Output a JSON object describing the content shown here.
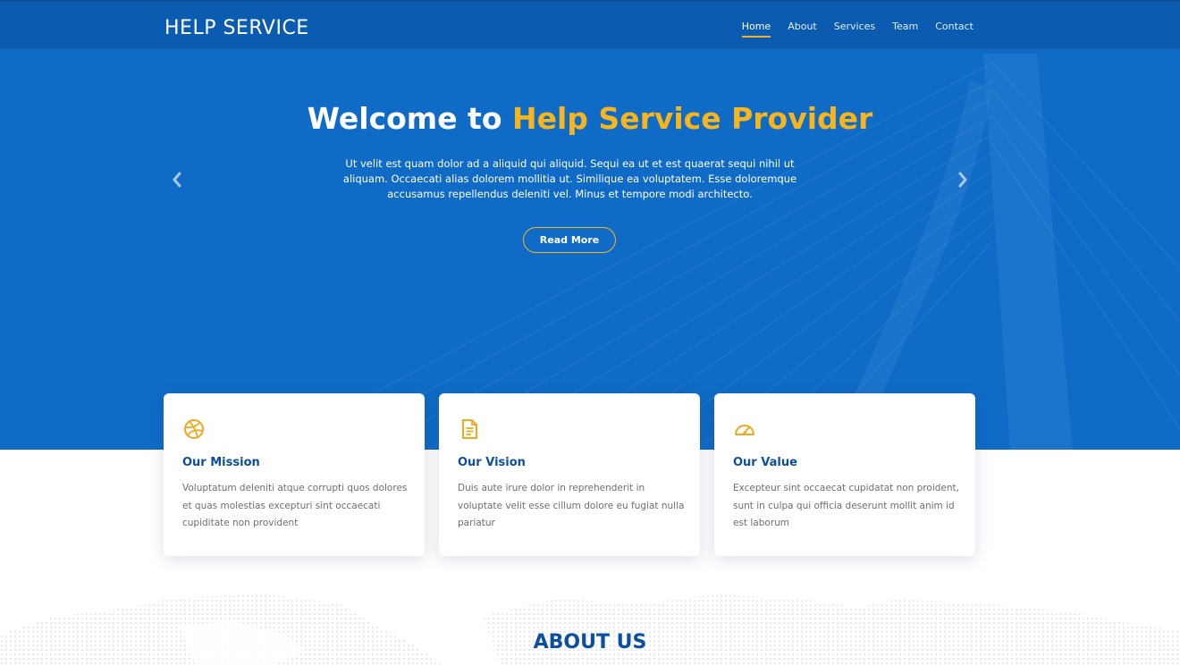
{
  "header": {
    "brand": "HELP SERVICE",
    "nav": [
      {
        "label": "Home",
        "active": true
      },
      {
        "label": "About",
        "active": false
      },
      {
        "label": "Services",
        "active": false
      },
      {
        "label": "Team",
        "active": false
      },
      {
        "label": "Contact",
        "active": false
      }
    ]
  },
  "hero": {
    "title_prefix": "Welcome to ",
    "title_accent": "Help Service Provider",
    "text": "Ut velit est quam dolor ad a aliquid qui aliquid. Sequi ea ut et est quaerat sequi nihil ut aliquam. Occaecati alias dolorem mollitia ut. Similique ea voluptatem. Esse doloremque accusamus repellendus deleniti vel. Minus et tempore modi architecto.",
    "button_label": "Read More",
    "prev_icon": "chevron-left-icon",
    "next_icon": "chevron-right-icon"
  },
  "cards": [
    {
      "icon": "dribbble-icon",
      "title": "Our Mission",
      "text": "Voluptatum deleniti atque corrupti quos dolores et quas molestias excepturi sint occaecati cupiditate non provident"
    },
    {
      "icon": "file-text-icon",
      "title": "Our Vision",
      "text": "Duis aute irure dolor in reprehenderit in voluptate velit esse cillum dolore eu fugiat nulla pariatur"
    },
    {
      "icon": "speedometer-icon",
      "title": "Our Value",
      "text": "Excepteur sint occaecat cupidatat non proident, sunt in culpa qui officia deserunt mollit anim id est laborum"
    }
  ],
  "about": {
    "title": "ABOUT US"
  },
  "colors": {
    "primary": "#0f6bc5",
    "header": "#0b5cb0",
    "accent": "#f6b51f",
    "heading": "#0b4f9e"
  }
}
